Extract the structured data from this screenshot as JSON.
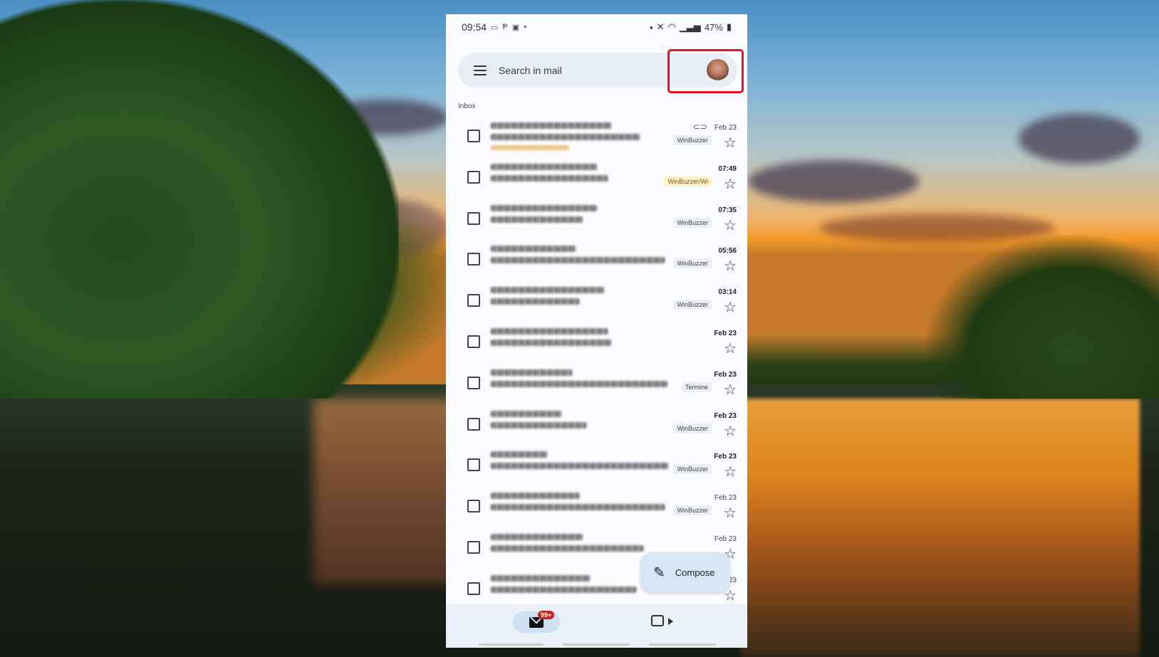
{
  "status_bar": {
    "time": "09:54",
    "battery": "47%"
  },
  "search": {
    "placeholder": "Search in mail"
  },
  "inbox": {
    "label": "Inbox"
  },
  "emails": [
    {
      "date": "Feb 23",
      "label": "WinBuzzer",
      "bold": false,
      "attachment": true
    },
    {
      "date": "07:49",
      "label": "WinBuzzer/Wi",
      "bold": true,
      "label_style": "yellow"
    },
    {
      "date": "07:35",
      "label": "WinBuzzer",
      "bold": true
    },
    {
      "date": "05:56",
      "label": "WinBuzzer",
      "bold": true
    },
    {
      "date": "03:14",
      "label": "WinBuzzer",
      "bold": true
    },
    {
      "date": "Feb 23",
      "label": "",
      "bold": true
    },
    {
      "date": "Feb 23",
      "label": "Termine",
      "bold": true
    },
    {
      "date": "Feb 23",
      "label": "WinBuzzer",
      "bold": true
    },
    {
      "date": "Feb 23",
      "label": "WinBuzzer",
      "bold": true
    },
    {
      "date": "Feb 23",
      "label": "WinBuzzer",
      "bold": false
    },
    {
      "date": "Feb 23",
      "label": "",
      "bold": false
    },
    {
      "date": "23",
      "label": "",
      "bold": false
    }
  ],
  "compose": {
    "label": "Compose"
  },
  "bottom_nav": {
    "mail_badge": "99+"
  },
  "colors": {
    "highlight": "#e4131e",
    "badge": "#c5221f",
    "search_bg": "#e8eef6",
    "compose_bg": "#d7e6f5"
  }
}
